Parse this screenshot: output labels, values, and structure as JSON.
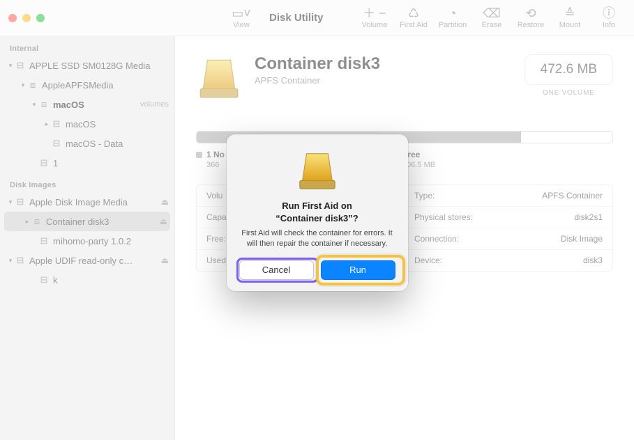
{
  "window": {
    "title": "Disk Utility"
  },
  "toolbar": {
    "view": "View",
    "volume": "Volume",
    "first_aid": "First Aid",
    "partition": "Partition",
    "erase": "Erase",
    "restore": "Restore",
    "mount": "Mount",
    "info": "Info"
  },
  "sidebar": {
    "sections": {
      "internal": "Internal",
      "disk_images": "Disk Images"
    },
    "internal": [
      {
        "label": "APPLE SSD SM0128G Media",
        "indent": 0,
        "chev": "▾",
        "ico": "⊟"
      },
      {
        "label": "AppleAPFSMedia",
        "indent": 1,
        "chev": "▾",
        "ico": "⧈"
      },
      {
        "label": "macOS",
        "suffix": "volumes",
        "indent": 2,
        "chev": "▾",
        "ico": "⧈",
        "bold": true
      },
      {
        "label": "macOS",
        "indent": 3,
        "chev": "▸",
        "ico": "⊟"
      },
      {
        "label": "macOS - Data",
        "indent": 3,
        "chev": "",
        "ico": "⊟"
      },
      {
        "label": "1",
        "indent": 2,
        "chev": "",
        "ico": "⊟"
      }
    ],
    "images": [
      {
        "label": "Apple Disk Image Media",
        "indent": 0,
        "chev": "▾",
        "ico": "⊟",
        "eject": true
      },
      {
        "label": "Container disk3",
        "indent": 1,
        "chev": "▸",
        "ico": "⧈",
        "eject": true,
        "selected": true
      },
      {
        "label": "mihomo-party 1.0.2",
        "indent": 2,
        "chev": "",
        "ico": "⊟"
      },
      {
        "label": "Apple UDIF read-only c…",
        "indent": 0,
        "chev": "▾",
        "ico": "⊟",
        "eject": true
      },
      {
        "label": "k",
        "indent": 2,
        "chev": "",
        "ico": "⊟"
      }
    ]
  },
  "volume": {
    "title": "Container disk3",
    "subtitle": "APFS Container",
    "size": "472.6 MB",
    "size_caption": "ONE VOLUME",
    "legend_used_label": "1 No",
    "legend_used_value": "366",
    "legend_free_label": "Free",
    "legend_free_value": "106.5 MB"
  },
  "info": {
    "left": [
      {
        "k": "Volu",
        "v": ""
      },
      {
        "k": "Capa",
        "v": ""
      },
      {
        "k": "Free:",
        "v": ""
      },
      {
        "k": "Used:",
        "v": ""
      }
    ],
    "right": [
      {
        "k": "Type:",
        "v": "APFS Container"
      },
      {
        "k": "Physical stores:",
        "v": "disk2s1"
      },
      {
        "k": "Connection:",
        "v": "Disk Image"
      },
      {
        "k": "Device:",
        "v": "disk3"
      }
    ]
  },
  "dialog": {
    "title_line1": "Run First Aid on",
    "title_line2": "“Container disk3”?",
    "body": "First Aid will check the container for errors. It will then repair the container if necessary.",
    "cancel": "Cancel",
    "run": "Run"
  }
}
